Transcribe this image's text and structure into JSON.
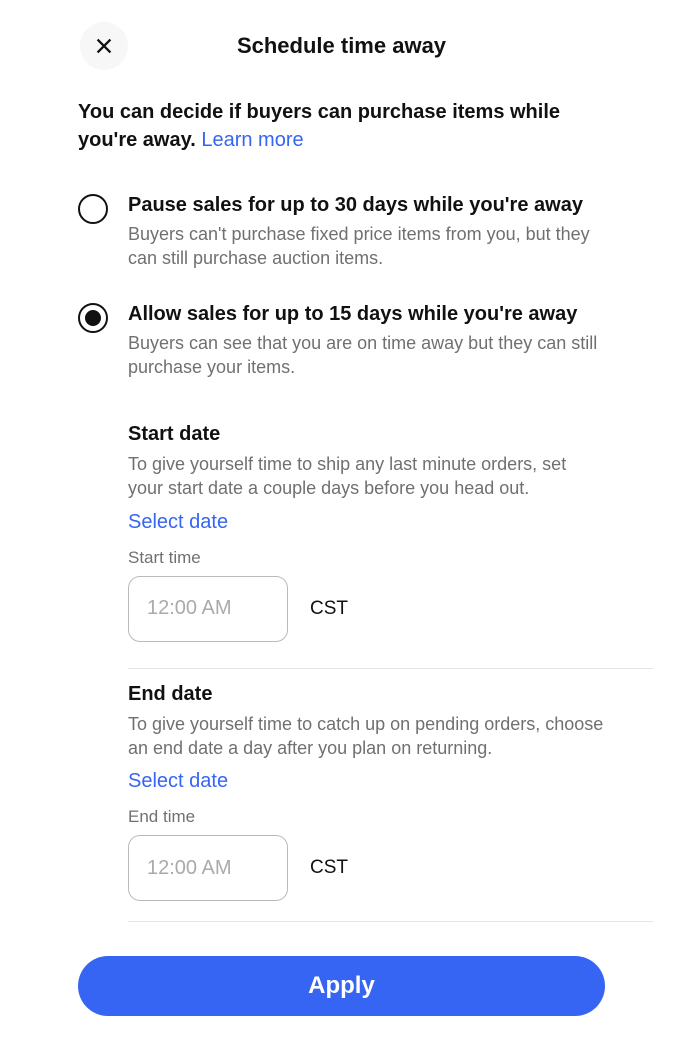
{
  "header": {
    "title": "Schedule time away"
  },
  "intro": {
    "text": "You can decide if buyers can purchase items while you're away.  ",
    "learn_more": "Learn more"
  },
  "options": [
    {
      "title": "Pause sales for up to 30 days while you're away",
      "desc": "Buyers can't purchase fixed price items from you, but they can still purchase auction items."
    },
    {
      "title": "Allow sales for up to 15 days while you're away",
      "desc": "Buyers can see that you are on time away but they can still purchase your items."
    }
  ],
  "start": {
    "title": "Start date",
    "desc": "To give yourself time to ship any last minute orders, set your start date a couple days before you head out.",
    "select": "Select date",
    "time_label": "Start time",
    "time_placeholder": "12:00 AM",
    "tz": "CST"
  },
  "end": {
    "title": "End date",
    "desc": "To give yourself time to catch up on pending orders, choose an end date a day after you plan on returning.",
    "select": "Select date",
    "time_label": "End time",
    "time_placeholder": "12:00 AM",
    "tz": "CST"
  },
  "footer": {
    "apply": "Apply"
  }
}
